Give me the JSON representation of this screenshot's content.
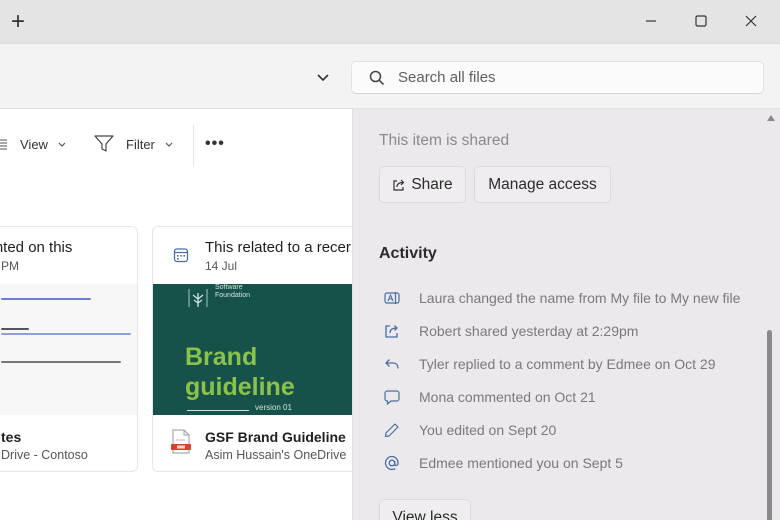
{
  "window": {
    "new_tab_label": "+",
    "controls": [
      "minimize",
      "maximize",
      "close"
    ]
  },
  "address_bar": {
    "search_placeholder": "Search all files",
    "search_value": ""
  },
  "toolbar": {
    "view_label": "View",
    "filter_label": "Filter",
    "more_label": "•••"
  },
  "cards": [
    {
      "reason": "...mmented on this",
      "date": "PM",
      "name": "tes",
      "location": "Drive - Contoso",
      "thumbnail": "document"
    },
    {
      "reason": "This related to a recer",
      "date": "14 Jul",
      "name": "GSF Brand Guideline",
      "location": "Asim Hussain's OneDrive",
      "thumbnail": "brand",
      "thumb_org_line1": "Software",
      "thumb_org_line2": "Foundation",
      "thumb_title_line1": "Brand",
      "thumb_title_line2": "guideline",
      "thumb_version": "version 01"
    }
  ],
  "details_panel": {
    "shared_label": "This item is shared",
    "share_button": "Share",
    "manage_access_button": "Manage access",
    "activity_title": "Activity",
    "activity": [
      {
        "icon": "rename-icon",
        "text": "Laura changed the name from My file to My new file"
      },
      {
        "icon": "share-icon",
        "text": "Robert shared yesterday at 2:29pm"
      },
      {
        "icon": "reply-icon",
        "text": "Tyler replied to a comment by Edmee on Oct 29"
      },
      {
        "icon": "comment-icon",
        "text": "Mona commented on Oct 21"
      },
      {
        "icon": "pencil-icon",
        "text": "You edited on Sept 20"
      },
      {
        "icon": "mention-icon",
        "text": "Edmee mentioned you on Sept 5"
      }
    ],
    "view_less_button": "View less"
  },
  "colors": {
    "icon_blue": "#4a6fa5",
    "brand_green_bg": "#17524a",
    "brand_green_text": "#8bc34a",
    "pdf_red": "#d9412e"
  }
}
